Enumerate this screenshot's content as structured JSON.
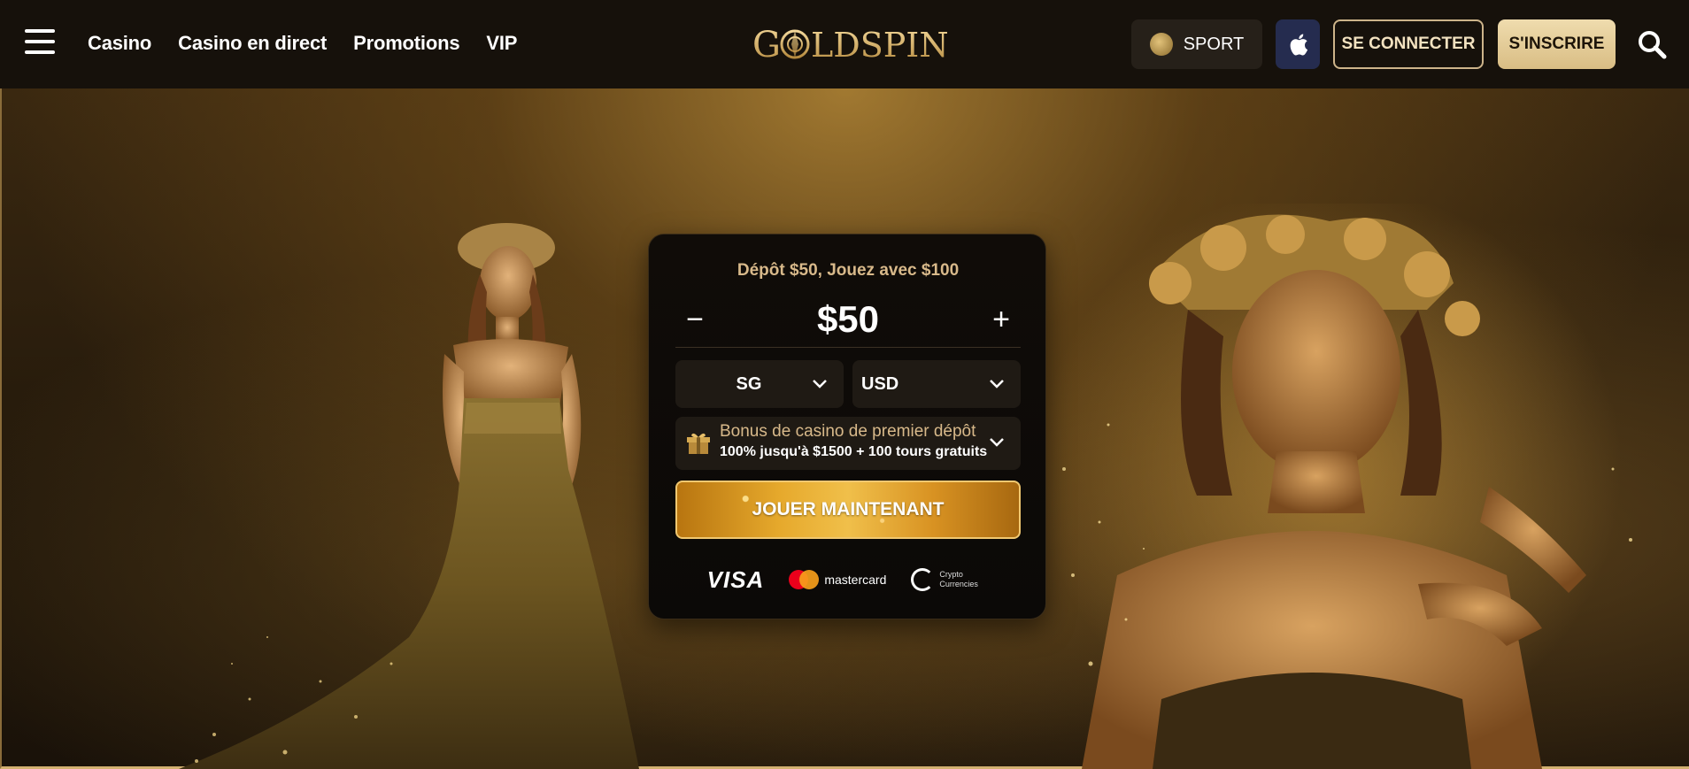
{
  "header": {
    "nav": [
      {
        "label": "Casino"
      },
      {
        "label": "Casino en direct"
      },
      {
        "label": "Promotions"
      },
      {
        "label": "VIP"
      }
    ],
    "logo_text": "GOLDSPIN",
    "sport_label": "SPORT",
    "login_label": "SE CONNECTER",
    "signup_label": "S'INSCRIRE"
  },
  "card": {
    "title": "Dépôt $50, Jouez avec $100",
    "amount": "$50",
    "minus": "−",
    "plus": "+",
    "country": "SG",
    "currency": "USD",
    "bonus_title": "Bonus de casino de premier dépôt",
    "bonus_detail": "100% jusqu'à $1500 + 100 tours gratuits",
    "play_label": "JOUER MAINTENANT",
    "payments": {
      "visa": "VISA",
      "mastercard": "mastercard",
      "crypto_line1": "Crypto",
      "crypto_line2": "Currencies"
    }
  },
  "colors": {
    "accent": "#d9b46a",
    "header_bg": "#16110b",
    "card_bg": "#0b0907",
    "play_button": "#e6a92c"
  }
}
